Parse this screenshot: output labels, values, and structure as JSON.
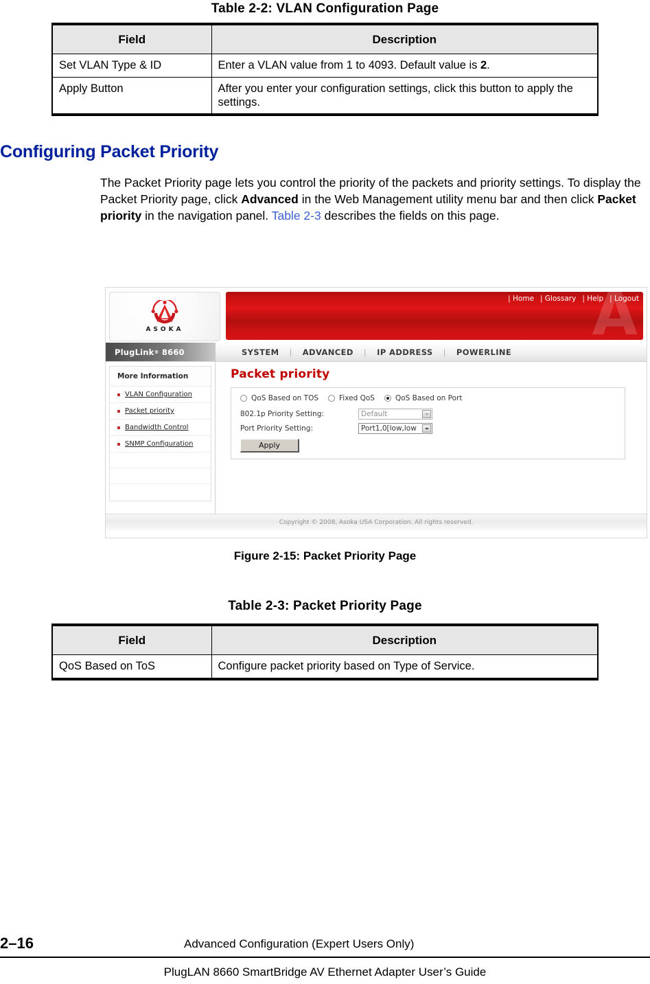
{
  "table_2_2": {
    "caption": "Table 2-2:  VLAN Configuration Page",
    "headers": [
      "Field",
      "Description"
    ],
    "rows": [
      [
        "Set VLAN Type & ID",
        "Enter a VLAN value from 1 to 4093. Default value is ",
        "2",
        "."
      ],
      [
        "Apply Button",
        "After you enter your configuration settings, click this button to apply the settings."
      ]
    ]
  },
  "section": {
    "heading": "Configuring Packet Priority",
    "para": {
      "p1": "The Packet Priority page lets you control the priority of the packets and priority settings. To display the Packet Priority page, click ",
      "b1": "Advanced",
      "p2": " in the Web Management utility menu bar and then click ",
      "b2": "Packet priority",
      "p3": " in the navigation panel. ",
      "xref": "Table 2-3",
      "p4": " describes the fields on this page."
    }
  },
  "screenshot": {
    "logo_word": "ASOKA",
    "banner_links": [
      "Home",
      "Glossary",
      "Help",
      "Logout"
    ],
    "brand": "PlugLink",
    "brand_sup": "®",
    "brand_model": "8660",
    "menu": [
      "SYSTEM",
      "ADVANCED",
      "IP ADDRESS",
      "POWERLINE"
    ],
    "sidebar": {
      "title": "More Information",
      "items": [
        "VLAN Configuration",
        "Packet priority",
        "Bandwidth Control",
        "SNMP Configuration"
      ]
    },
    "content": {
      "title": "Packet priority",
      "radios": [
        {
          "label": "QoS Based on TOS",
          "selected": false
        },
        {
          "label": "Fixed QoS",
          "selected": false
        },
        {
          "label": "QoS Based on Port",
          "selected": true
        }
      ],
      "fields": [
        {
          "label": "802.1p Priority Setting:",
          "value": "Default",
          "disabled": true
        },
        {
          "label": "Port Priority Setting:",
          "value": "Port1,0[low,low",
          "disabled": false
        }
      ],
      "apply_label": "Apply"
    },
    "footer": "Copyright © 2008, Asoka USA Corporation. All rights reserved."
  },
  "figure_caption": "Figure 2-15:  Packet Priority Page",
  "table_2_3": {
    "caption": "Table 2-3:  Packet Priority Page",
    "headers": [
      "Field",
      "Description"
    ],
    "rows": [
      [
        "QoS Based on ToS",
        "Configure packet priority based on Type of Service."
      ]
    ]
  },
  "page_footer": {
    "page_number": "2–16",
    "chapter": "Advanced Configuration (Expert Users Only)",
    "guide": "PlugLAN 8660 SmartBridge AV Ethernet Adapter User’s Guide"
  },
  "colors": {
    "heading_blue": "#00209c",
    "xref_blue": "#3b5fd0",
    "brand_red": "#c00000",
    "header_band": "#e6e6e6"
  }
}
